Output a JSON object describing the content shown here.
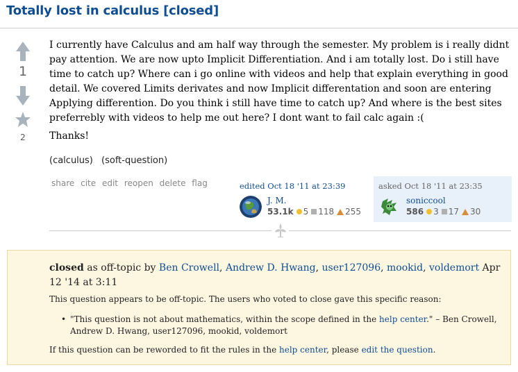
{
  "question": {
    "title": "Totally lost in calculus [closed]",
    "vote_count": "1",
    "favorite_count": "2",
    "body": "I currently have Calculus and am half way through the semester. My problem is i really didnt pay attention. We are now upto Implicit Differentiation. And i am totally lost. Do i still have time to catch up? Where can i go online with videos and help that explain everything in good detail. We covered Limits derivates and now Implicit differentation and soon are entering Applying differention. Do you think i still have time to catch up? And where is the best sites preferrebly with videos to help me out here? I dont want to fail calc again :(",
    "thanks": "Thanks!",
    "tags": [
      "(calculus)",
      "(soft-question)"
    ],
    "menu": [
      "share",
      "cite",
      "edit",
      "reopen",
      "delete",
      "flag"
    ]
  },
  "editor": {
    "label": "edited Oct 18 '11 at 23:39",
    "name": "J. M.",
    "reputation": "53.1k",
    "gold": "5",
    "silver": "118",
    "bronze": "255"
  },
  "asker": {
    "label": "asked Oct 18 '11 at 23:35",
    "name": "soniccool",
    "reputation": "586",
    "gold": "3",
    "silver": "17",
    "bronze": "30"
  },
  "closed": {
    "prefix": "closed",
    "reason_label": " as off-topic by ",
    "voters": [
      "Ben Crowell",
      "Andrew D. Hwang",
      "user127096",
      "mookid",
      "voldemort"
    ],
    "date": " Apr 12 '14 at 3:11",
    "intro": "This question appears to be off-topic. The users who voted to close gave this specific reason:",
    "quote_start": "\"This question is not about mathematics, within the scope defined in the ",
    "help_center": "help center",
    "quote_end": ".\" – Ben Crowell, Andrew D. Hwang, user127096, mookid, voldemort",
    "footer_start": "If this question can be reworded to fit the rules in the ",
    "footer_mid": ", please ",
    "edit_question": "edit the question",
    "footer_end": "."
  },
  "colors": {
    "title": "#0f4d92",
    "link": "#0f4d92",
    "gold": "#f0c030",
    "silver": "#b0b0b0",
    "bronze": "#d98b3a",
    "asked_bg": "#e8f0fa",
    "closed_bg": "#fdf7e2"
  },
  "icons": [
    "vote-up-icon",
    "vote-down-icon",
    "favorite-star-icon",
    "fleuron-icon"
  ]
}
